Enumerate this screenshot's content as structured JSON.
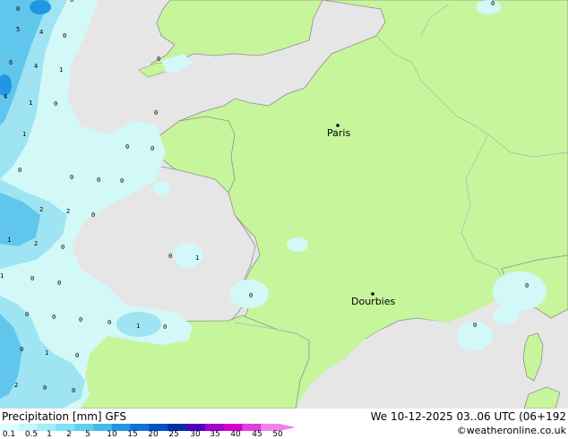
{
  "map": {
    "cities": [
      {
        "name": "Paris"
      },
      {
        "name": "Dourbies"
      }
    ],
    "precip_values": [
      "5",
      "4",
      "0",
      "6",
      "4",
      "1",
      "4",
      "1",
      "0",
      "1",
      "0",
      "0",
      "0",
      "0",
      "0",
      "0",
      "0",
      "0",
      "2",
      "2",
      "0",
      "1",
      "2",
      "0",
      "1",
      "0",
      "0",
      "0",
      "1",
      "0",
      "0",
      "0",
      "0",
      "0",
      "1",
      "0",
      "0",
      "1",
      "0",
      "2",
      "0",
      "0",
      "0",
      "0",
      "0",
      "0",
      "0"
    ]
  },
  "footer": {
    "title": "Precipitation [mm] GFS",
    "datetime": "We 10-12-2025 03..06 UTC (06+192",
    "credit": "©weatheronline.co.uk",
    "scale_labels": [
      "0.1",
      "0.5",
      "1",
      "2",
      "5",
      "10",
      "15",
      "20",
      "25",
      "30",
      "35",
      "40",
      "45",
      "50"
    ],
    "scale_colors": [
      "#e0ffff",
      "#c0f8fb",
      "#a0eef8",
      "#80e0f4",
      "#60cff0",
      "#40bcec",
      "#2096e4",
      "#1070dc",
      "#0050c8",
      "#0030a8",
      "#5000c0",
      "#a000d0",
      "#d000d0",
      "#e040e0",
      "#f080f0"
    ]
  },
  "colors": {
    "land": "#c6f59c",
    "sea": "#e6e6e6",
    "light_precip": "#d2f8f8",
    "medium_precip": "#9ee4f2",
    "heavy_precip": "#60c6ec",
    "coast": "#909090",
    "border": "#b0b0b0"
  }
}
